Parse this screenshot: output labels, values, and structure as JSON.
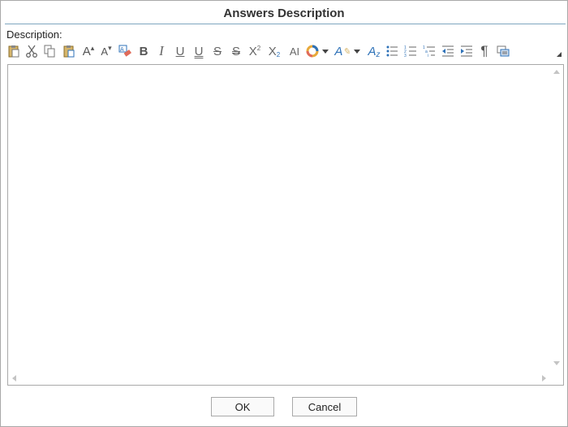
{
  "dialog": {
    "title": "Answers Description",
    "description_label": "Description:"
  },
  "toolbar": {
    "buttons": [
      {
        "name": "paste-icon",
        "glyph": ""
      },
      {
        "name": "cut-icon",
        "glyph": ""
      },
      {
        "name": "copy-icon",
        "glyph": ""
      },
      {
        "name": "paste-special-icon",
        "glyph": ""
      },
      {
        "name": "increase-font-size-icon",
        "glyph": "A"
      },
      {
        "name": "decrease-font-size-icon",
        "glyph": "A"
      },
      {
        "name": "clear-formatting-icon",
        "glyph": ""
      },
      {
        "name": "bold-icon",
        "glyph": "B"
      },
      {
        "name": "italic-icon",
        "glyph": "I"
      },
      {
        "name": "underline-icon",
        "glyph": "U"
      },
      {
        "name": "double-underline-icon",
        "glyph": "U"
      },
      {
        "name": "strikethrough-icon",
        "glyph": "S"
      },
      {
        "name": "double-strikethrough-icon",
        "glyph": "S"
      },
      {
        "name": "superscript-icon",
        "glyph": "X"
      },
      {
        "name": "subscript-icon",
        "glyph": "X"
      },
      {
        "name": "change-case-icon",
        "glyph": "AI"
      },
      {
        "name": "highlight-color-icon",
        "glyph": ""
      },
      {
        "name": "font-color-icon",
        "glyph": "A"
      },
      {
        "name": "font-style-icon",
        "glyph": "A"
      },
      {
        "name": "bullet-list-icon",
        "glyph": ""
      },
      {
        "name": "numbered-list-icon",
        "glyph": ""
      },
      {
        "name": "multilevel-list-icon",
        "glyph": ""
      },
      {
        "name": "decrease-indent-icon",
        "glyph": ""
      },
      {
        "name": "increase-indent-icon",
        "glyph": ""
      },
      {
        "name": "show-paragraph-marks-icon",
        "glyph": "¶"
      },
      {
        "name": "text-box-icon",
        "glyph": ""
      }
    ]
  },
  "editor": {
    "content": ""
  },
  "footer": {
    "ok_label": "OK",
    "cancel_label": "Cancel"
  },
  "colors": {
    "title_rule": "#7fa6c0",
    "border": "#a9a9a9",
    "icon_gray": "#666666",
    "accent_blue": "#2e72b8"
  }
}
